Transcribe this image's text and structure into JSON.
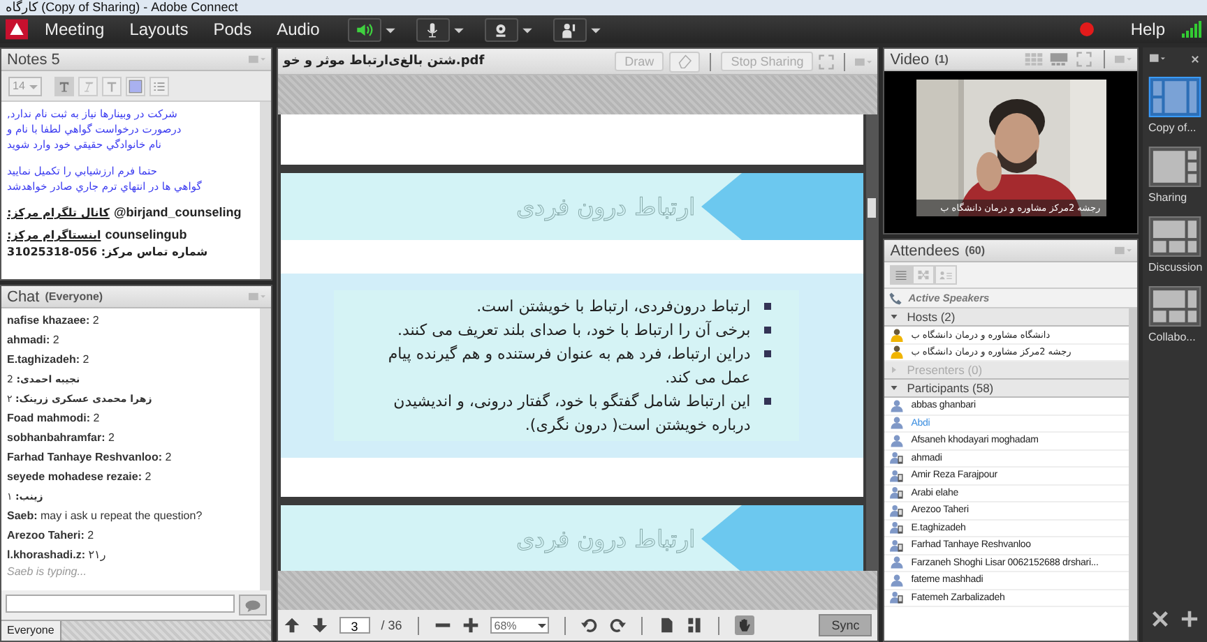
{
  "window": {
    "title": "کارگاه (Copy of Sharing) - Adobe Connect"
  },
  "menu": {
    "meeting": "Meeting",
    "layouts": "Layouts",
    "pods": "Pods",
    "audio": "Audio"
  },
  "speaker": {
    "on": true
  },
  "recording": true,
  "help": "Help",
  "notes": {
    "title": "Notes 5",
    "font_size": "14",
    "paragraphs": [
      [
        "شرکت در وبینارها نیاز به ثبت نام ندارد,",
        "درصورت درخواست گواهي لطفا با نام و",
        "نام خانوادگي حقيقي خود وارد شويد"
      ],
      [
        "حتما فرم ارزشيابي را تكميل نماييد",
        "گواهي ها در انتهاي ترم جاري صادر خواهدشد"
      ]
    ],
    "contacts": [
      {
        "channel": "كانال تلگرام مركز:",
        "handle": "@birjand_counseling"
      },
      {
        "channel": "اينستاگرام مركز:",
        "handle": "counselingub"
      }
    ],
    "phone": "شماره تماس مركز: 056-31025318"
  },
  "chat": {
    "title": "Chat",
    "scope": "(Everyone)",
    "messages": [
      {
        "kind": "ltr",
        "sender": "nafise khazaee:",
        "text": "2"
      },
      {
        "kind": "ltr",
        "sender": "ahmadi:",
        "text": "2"
      },
      {
        "kind": "ltr",
        "sender": "E.taghizadeh:",
        "text": "2"
      },
      {
        "kind": "rtl",
        "sender": "نجیبه احمدی:",
        "text": "2"
      },
      {
        "kind": "rtl",
        "sender": "زهرا محمدی عسکری زرینک:",
        "text": "۲"
      },
      {
        "kind": "ltr",
        "sender": "Foad mahmodi:",
        "text": "2"
      },
      {
        "kind": "ltr",
        "sender": "sobhanbahramfar:",
        "text": "2"
      },
      {
        "kind": "ltr",
        "sender": "Farhad Tanhaye Reshvanloo:",
        "text": "2"
      },
      {
        "kind": "ltr",
        "sender": "seyede mohadese rezaie:",
        "text": "2"
      },
      {
        "kind": "rtl",
        "sender": "زینب:",
        "text": "۱"
      },
      {
        "kind": "ltr",
        "sender": "Saeb:",
        "text": "may i ask u repeat the question?"
      },
      {
        "kind": "ltr",
        "sender": "Arezoo Taheri:",
        "text": "2"
      },
      {
        "kind": "ltr",
        "sender": "l.khorashadi.z:",
        "text": "۲ر۱"
      }
    ],
    "typing": "Saeb is typing...",
    "tab": "Everyone"
  },
  "share": {
    "title": "شتن بالغ‌ی‌ارتباط موثر و خو.pdf",
    "draw_button": "Draw",
    "stop_sharing_button": "Stop Sharing",
    "slides": [
      {
        "title": "ارتباط درون فردی",
        "bullets": [
          "ارتباط درون‌فردی، ارتباط با خویشتن است.",
          "برخی آن را ارتباط با خود، با صدای بلند تعریف می کنند.",
          "دراین ارتباط، فرد هم به عنوان فرستنده و هم گیرنده پیام عمل می کند.",
          "این ارتباط شامل گفتگو با خود، گفتار درونی، و اندیشیدن درباره خویشتن است( درون نگری)."
        ]
      },
      {
        "title": "ارتباط درون فردی"
      }
    ],
    "page": "3",
    "pages": "/ 36",
    "zoom": "68%",
    "sync": "Sync"
  },
  "video": {
    "title": "Video",
    "count": "(1)",
    "caption": "رجشه 2مرکز مشاوره و درمان دانشگاه ب"
  },
  "attendees": {
    "title": "Attendees",
    "count": "(60)",
    "active_speakers": "Active Speakers",
    "groups": [
      {
        "label": "Hosts (2)",
        "expanded": true,
        "disabled": false,
        "people": [
          {
            "kind": "host",
            "name": "دانشگاه مشاوره و درمان دانشگاه ب",
            "selected": false
          },
          {
            "kind": "host",
            "name": "رجشه 2مرکز مشاوره و درمان دانشگاه ب",
            "selected": false
          }
        ]
      },
      {
        "label": "Presenters (0)",
        "expanded": false,
        "disabled": true
      },
      {
        "label": "Participants (58)",
        "expanded": true,
        "disabled": false,
        "people": [
          {
            "kind": "person",
            "name": "abbas ghanbari",
            "selected": false
          },
          {
            "kind": "person",
            "name": "Abdi",
            "selected": true
          },
          {
            "kind": "person",
            "name": "Afsaneh khodayari moghadam",
            "selected": false
          },
          {
            "kind": "mobile",
            "name": "ahmadi",
            "selected": false
          },
          {
            "kind": "mobile",
            "name": "Amir Reza Farajpour",
            "selected": false
          },
          {
            "kind": "mobile",
            "name": "Arabi elahe",
            "selected": false
          },
          {
            "kind": "mobile",
            "name": "Arezoo Taheri",
            "selected": false
          },
          {
            "kind": "mobile",
            "name": "E.taghizadeh",
            "selected": false
          },
          {
            "kind": "mobile",
            "name": "Farhad Tanhaye Reshvanloo",
            "selected": false
          },
          {
            "kind": "person",
            "name": "Farzaneh Shoghi Lisar 0062152688 drshari...",
            "selected": false
          },
          {
            "kind": "person",
            "name": "fateme mashhadi",
            "selected": false
          },
          {
            "kind": "mobile",
            "name": "Fatemeh Zarbalizadeh",
            "selected": false
          }
        ]
      }
    ]
  },
  "layouts": [
    {
      "label": "Copy of...",
      "selected": true
    },
    {
      "label": "Sharing",
      "selected": false
    },
    {
      "label": "Discussion",
      "selected": false
    },
    {
      "label": "Collabo...",
      "selected": false
    }
  ]
}
